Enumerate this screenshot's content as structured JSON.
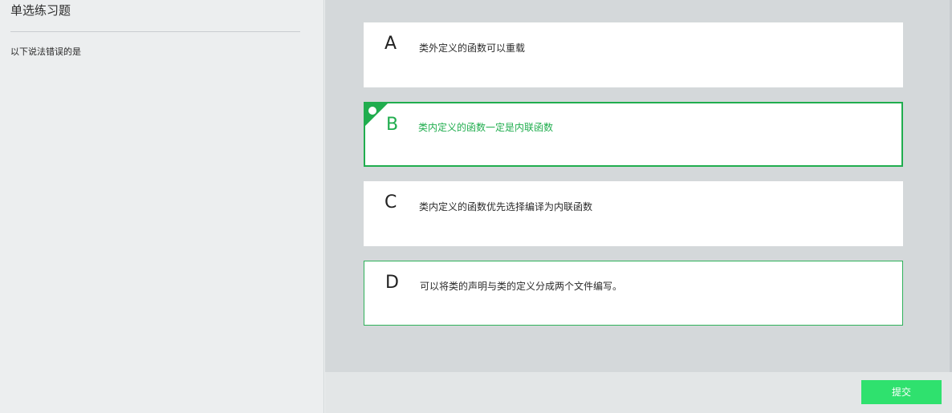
{
  "left": {
    "title": "单选练习题",
    "question": "以下说法错误的是"
  },
  "options": [
    {
      "letter": "A",
      "text": "类外定义的函数可以重载",
      "state": "normal"
    },
    {
      "letter": "B",
      "text": "类内定义的函数一定是内联函数",
      "state": "selected"
    },
    {
      "letter": "C",
      "text": "类内定义的函数优先选择编译为内联函数",
      "state": "normal"
    },
    {
      "letter": "D",
      "text": "可以将类的声明与类的定义分成两个文件编写。",
      "state": "outlined"
    }
  ],
  "footer": {
    "submit_label": "提交"
  },
  "colors": {
    "accent": "#20ad4e",
    "submit": "#2fe16e",
    "left_bg": "#eceeef",
    "right_bg": "#d4d8da"
  }
}
